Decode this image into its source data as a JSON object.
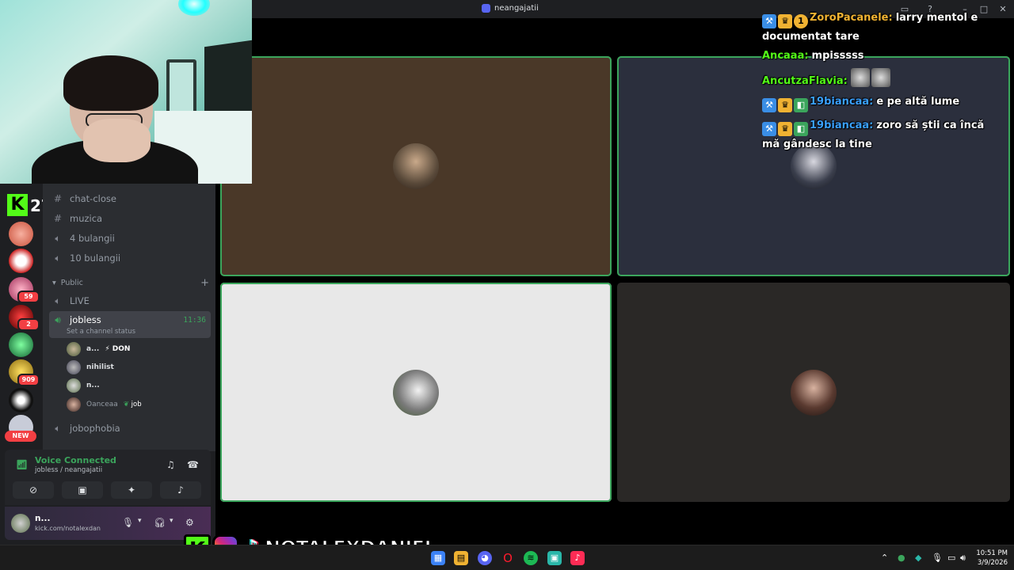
{
  "window": {
    "title": "neangajatii"
  },
  "server": {
    "level_badge": "27"
  },
  "rail": {
    "badges": [
      "59",
      "2",
      "909"
    ],
    "new_label": "NEW"
  },
  "channels": {
    "items": [
      {
        "type": "text",
        "name": "chat-close"
      },
      {
        "type": "text",
        "name": "muzica"
      },
      {
        "type": "voice",
        "name": "4 bulangii"
      },
      {
        "type": "voice",
        "name": "10 bulangii"
      }
    ],
    "category": "Public",
    "public_items": [
      {
        "type": "voice",
        "name": "LIVE"
      },
      {
        "type": "voice",
        "name": "jobless",
        "time": "11:36",
        "status": "Set a channel status"
      },
      {
        "type": "voice",
        "name": "jobophobia"
      }
    ],
    "voice_users": [
      {
        "name": "a...",
        "tag": "⚡ DON"
      },
      {
        "name": "nihilist",
        "tag": ""
      },
      {
        "name": "n...",
        "tag": ""
      },
      {
        "name": "Oanceaa",
        "tag": "job"
      }
    ]
  },
  "voice_panel": {
    "status": "Voice Connected",
    "location": "jobless / neangajatii"
  },
  "user_panel": {
    "name": "n...",
    "status": "kick.com/notalexdan"
  },
  "chat": [
    {
      "user": "ZoroPacanele:",
      "user_color": "#f0b232",
      "text": "larry mentol e documentat tare"
    },
    {
      "user": "Ancaaa:",
      "user_color": "#53fc18",
      "text": "mpisssss"
    },
    {
      "user": "AncutzaFlavia:",
      "user_color": "#53fc18",
      "text": ""
    },
    {
      "user": "19biancaa:",
      "user_color": "#3aa0ff",
      "text": "e pe altă lume"
    },
    {
      "user": "19biancaa:",
      "user_color": "#3aa0ff",
      "text": "zoro să știi ca încă mă gândesc la tine"
    }
  ],
  "watermark": {
    "handle": "NOTALEXDANIEL"
  },
  "taskbar": {
    "time": "10:51 PM",
    "date": "3/9/2026"
  },
  "colors": {
    "speaking": "#3ba55c",
    "tile_brown": "#4a3828",
    "tile_navy": "#2b2f3d",
    "tile_light": "#e8e8e8",
    "tile_dark": "#2a2826"
  }
}
